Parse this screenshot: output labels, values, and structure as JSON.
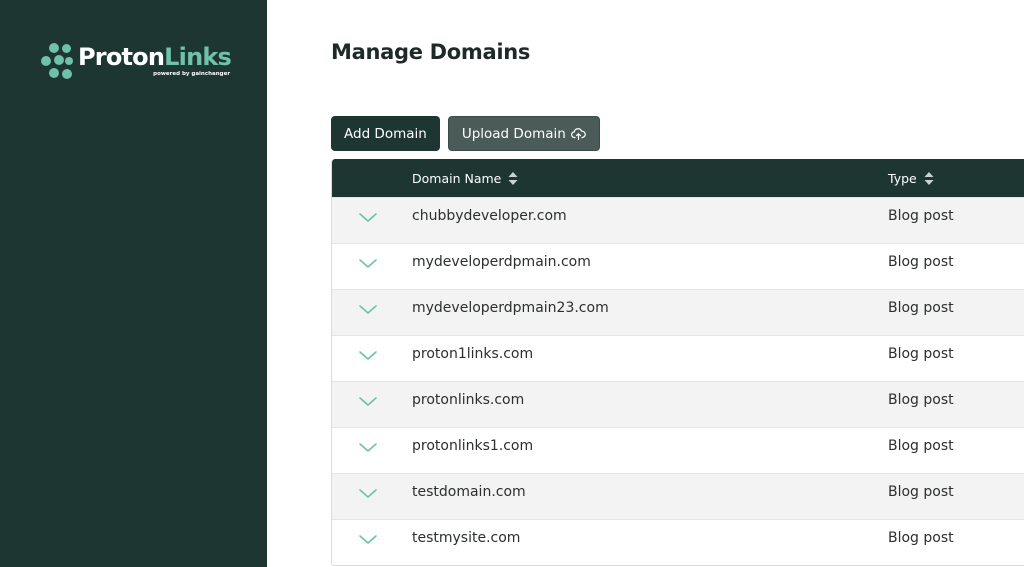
{
  "brand": {
    "name_part1": "Proton",
    "name_part2": "Links",
    "tagline": "powered by gainchanger"
  },
  "page": {
    "title": "Manage Domains"
  },
  "toolbar": {
    "add_label": "Add Domain",
    "upload_label": "Upload Domain"
  },
  "table": {
    "columns": {
      "name": "Domain Name",
      "type": "Type"
    },
    "rows": [
      {
        "name": "chubbydeveloper.com",
        "type": "Blog post"
      },
      {
        "name": "mydeveloperdpmain.com",
        "type": "Blog post"
      },
      {
        "name": "mydeveloperdpmain23.com",
        "type": "Blog post"
      },
      {
        "name": "proton1links.com",
        "type": "Blog post"
      },
      {
        "name": "protonlinks.com",
        "type": "Blog post"
      },
      {
        "name": "protonlinks1.com",
        "type": "Blog post"
      },
      {
        "name": "testdomain.com",
        "type": "Blog post"
      },
      {
        "name": "testmysite.com",
        "type": "Blog post"
      }
    ]
  },
  "colors": {
    "sidebar": "#1e3632",
    "accent": "#6fc1a9",
    "header": "#1e3632"
  }
}
